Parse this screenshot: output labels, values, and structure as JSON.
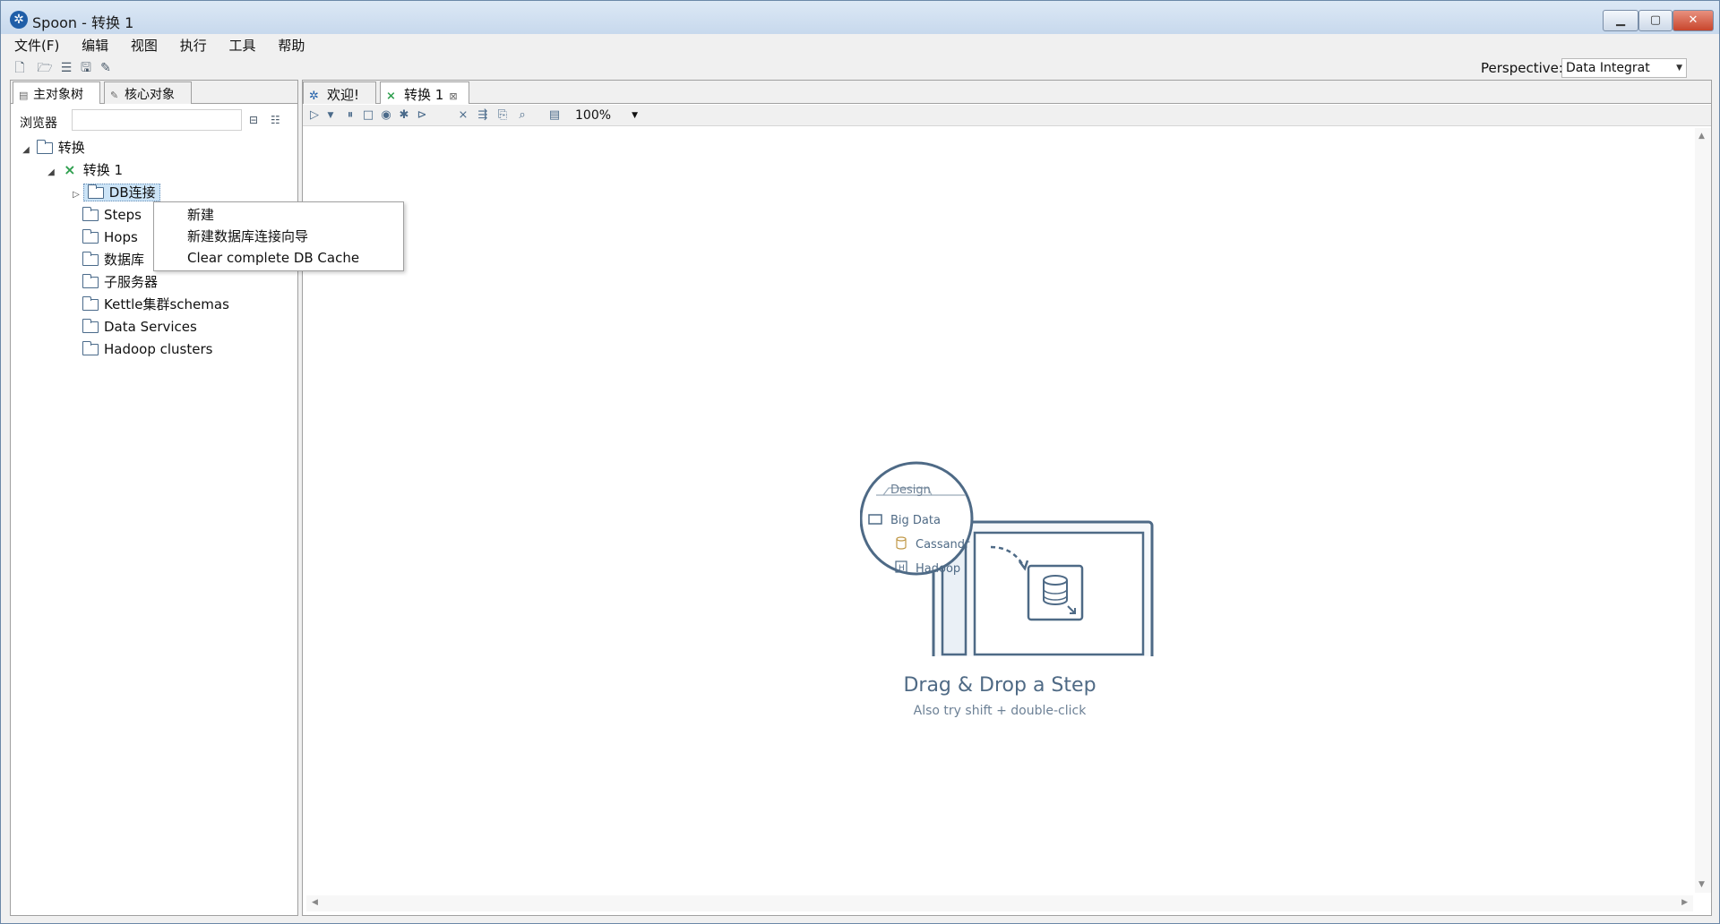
{
  "window": {
    "title": "Spoon - 转换 1"
  },
  "menu": [
    "文件(F)",
    "编辑",
    "视图",
    "执行",
    "工具",
    "帮助"
  ],
  "perspective": {
    "label": "Perspective:",
    "value": "Data Integrat"
  },
  "left_panel": {
    "tabs": [
      "主对象树",
      "核心对象"
    ],
    "browser_label": "浏览器",
    "search_placeholder": "",
    "tree": {
      "root": "转换",
      "transformation": "转换 1",
      "items": [
        "DB连接",
        "Steps",
        "Hops",
        "数据库",
        "子服务器",
        "Kettle集群schemas",
        "Data Services",
        "Hadoop clusters"
      ]
    }
  },
  "context_menu": {
    "items": [
      "新建",
      "新建数据库连接向导",
      "Clear complete DB Cache"
    ]
  },
  "right_panel": {
    "tabs": [
      "欢迎!",
      "转换 1"
    ],
    "zoom": "100%",
    "canvas": {
      "title": "Drag & Drop a Step",
      "subtitle": "Also try shift + double-click",
      "illustration": {
        "tab": "Design",
        "folder": "Big Data",
        "item1": "Cassandr",
        "item2": "Hadoop"
      }
    }
  }
}
